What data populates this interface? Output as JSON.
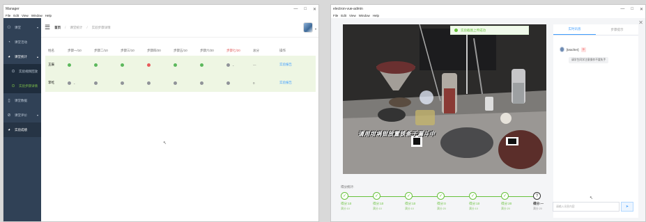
{
  "left_window": {
    "title": "Manager",
    "menu": [
      "File",
      "Edit",
      "View",
      "Window",
      "Help"
    ],
    "controls": [
      "—",
      "□",
      "✕"
    ],
    "sidebar": {
      "items": [
        {
          "label": "课堂",
          "icon": "user-icon",
          "arrow": "▾",
          "state": "normal"
        },
        {
          "label": "课堂活动",
          "icon": "chat-icon",
          "arrow": "",
          "state": "normal"
        },
        {
          "label": "课堂统计",
          "icon": "pie-icon",
          "arrow": "▴",
          "state": "open"
        },
        {
          "label": "实验视频回放",
          "icon": "location-icon",
          "arrow": "",
          "state": "sub"
        },
        {
          "label": "实验步骤详情",
          "icon": "location-icon",
          "arrow": "",
          "state": "sub-active"
        },
        {
          "label": "课堂数据",
          "icon": "doc-icon",
          "arrow": "",
          "state": "normal"
        },
        {
          "label": "课堂评价",
          "icon": "check-circle-icon",
          "arrow": "▾",
          "state": "normal"
        },
        {
          "label": "实验成绩",
          "icon": "pie-icon",
          "arrow": "",
          "state": "strong"
        }
      ]
    },
    "breadcrumb": {
      "home": "首页",
      "items": [
        "课堂统计",
        "实验步骤详情"
      ],
      "sep": "/"
    },
    "table": {
      "headers": [
        "姓名",
        "步骤一/10",
        "步骤二/10",
        "步骤三/10",
        "步骤四/20",
        "步骤五/10",
        "步骤六/20",
        "步骤七/20",
        "总分",
        "操作"
      ],
      "red_header_index": 7,
      "rows": [
        {
          "name": "王辰",
          "status": [
            "ok",
            "ok",
            "ok",
            "err",
            "ok",
            "ok",
            "gray"
          ],
          "caret_after": [
            6
          ],
          "score": "—",
          "action": "实验报告",
          "highlight": true
        },
        {
          "name": "李屹",
          "status": [
            "gray",
            "gray",
            "gray",
            "gray",
            "gray",
            "gray",
            "gray"
          ],
          "caret_after": [
            0
          ],
          "score": "0",
          "action": "实验报告",
          "highlight": true
        }
      ]
    }
  },
  "right_window": {
    "title": "electron-vue-admin",
    "menu": [
      "File",
      "Edit",
      "View",
      "Window",
      "Help"
    ],
    "controls": [
      "—",
      "□",
      "✕"
    ],
    "toast": "实验截图上传成功",
    "caption": "请用坩埚钳放置铁条于漏斗中",
    "hint": "得分统计:",
    "steps": [
      {
        "label": "得分:10",
        "sub": "满分:10",
        "state": "done"
      },
      {
        "label": "得分:10",
        "sub": "满分:10",
        "state": "done"
      },
      {
        "label": "得分:10",
        "sub": "满分:10",
        "state": "done"
      },
      {
        "label": "得分:0",
        "sub": "满分:20",
        "state": "done"
      },
      {
        "label": "得分:10",
        "sub": "满分:10",
        "state": "done"
      },
      {
        "label": "得分:20",
        "sub": "满分:20",
        "state": "done"
      },
      {
        "label": "得分:—",
        "sub": "满分:20",
        "state": "pending"
      }
    ],
    "tabs": [
      "实时讯息",
      "步骤提示"
    ],
    "message": {
      "sender": "[teacher]",
      "tag": "师",
      "text": "请学生同学注意操作不要失手"
    },
    "input_placeholder": "请输入讯息内容",
    "send_icon": "send-icon",
    "send_label": "➤"
  },
  "colors": {
    "sidebar_bg": "#304156",
    "accent_green": "#67c23a",
    "accent_blue": "#409eff",
    "error_red": "#e85a5a"
  }
}
